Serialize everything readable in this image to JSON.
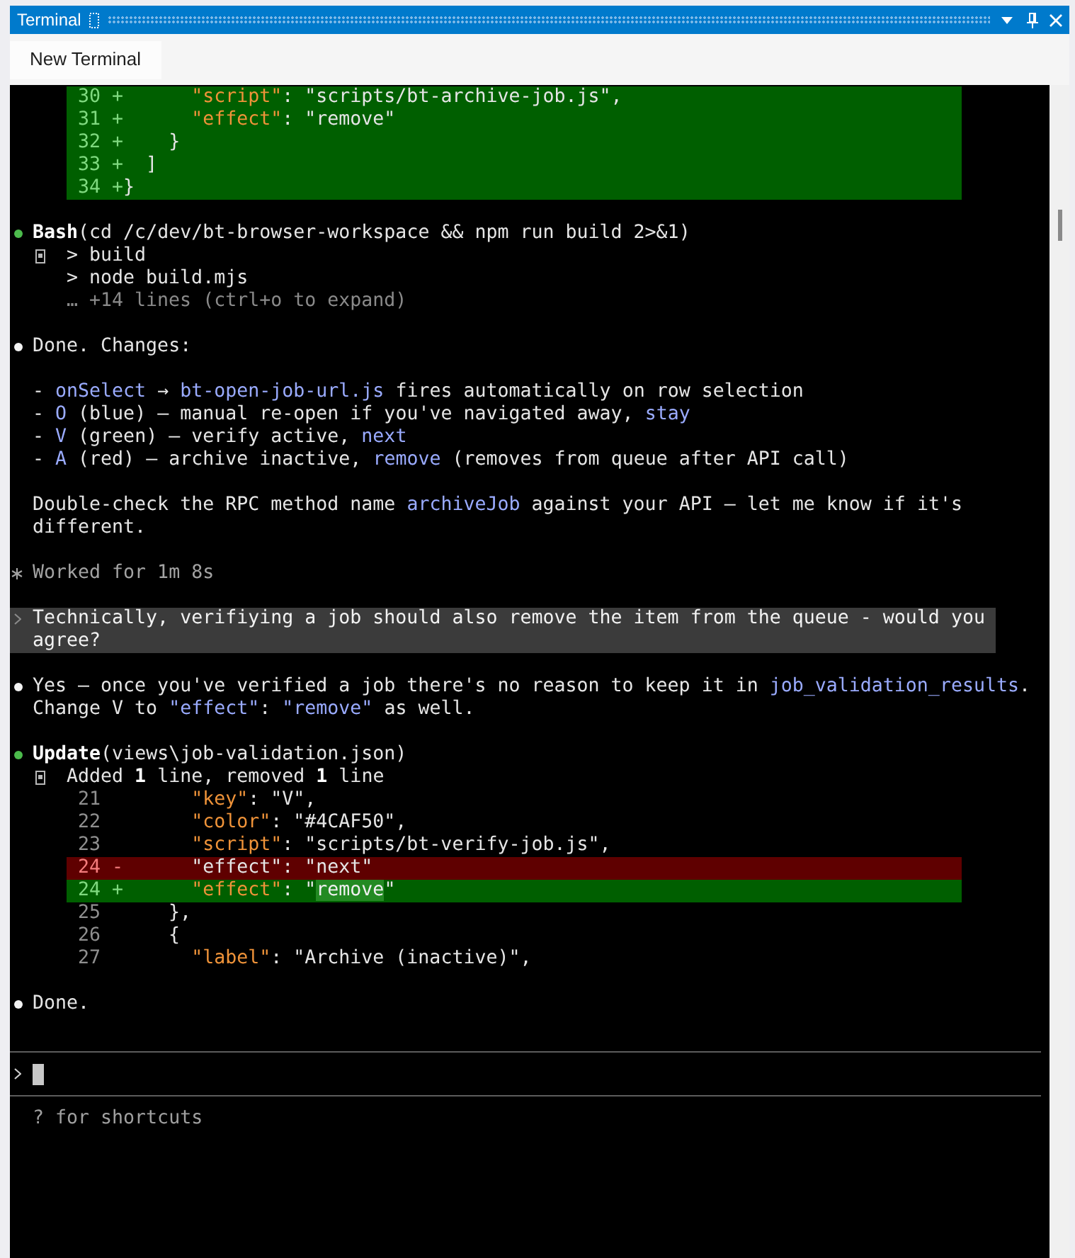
{
  "window": {
    "title": "Terminal"
  },
  "toolbar": {
    "buttons": [
      "New Terminal"
    ]
  },
  "transcript": [
    {
      "kind": "diff",
      "lines": [
        {
          "number": "30",
          "sign": "+",
          "kind": "added",
          "code": [
            {
              "text": "      \"script\"",
              "kind": "key"
            },
            {
              "text": ": \"scripts/bt-archive-job.js\",",
              "kind": "plain"
            }
          ]
        },
        {
          "number": "31",
          "sign": "+",
          "kind": "added",
          "code": [
            {
              "text": "      \"effect\"",
              "kind": "key"
            },
            {
              "text": ": \"remove\"",
              "kind": "plain"
            }
          ]
        },
        {
          "number": "32",
          "sign": "+",
          "kind": "added",
          "code": [
            {
              "text": "    }",
              "kind": "plain"
            }
          ]
        },
        {
          "number": "33",
          "sign": "+",
          "kind": "added",
          "code": [
            {
              "text": "  ]",
              "kind": "plain"
            }
          ]
        },
        {
          "number": "34",
          "sign": "+",
          "kind": "added",
          "code": [
            {
              "text": "}",
              "kind": "plain"
            }
          ]
        }
      ]
    },
    {
      "kind": "tool",
      "name": "Bash",
      "args": "(cd /c/dev/bt-browser-workspace && npm run build 2>&1)",
      "output": [
        {
          "kind": "output",
          "text": "> build"
        },
        {
          "kind": "output",
          "text": "> node build.mjs"
        },
        {
          "kind": "hint",
          "text": "… +14 lines (ctrl+o to expand)"
        }
      ]
    },
    {
      "kind": "message",
      "blocks": [
        {
          "kind": "paragraph",
          "spans": [
            {
              "kind": "text",
              "text": "Done. Changes:"
            }
          ]
        },
        {
          "kind": "list",
          "items": [
            {
              "spans": [
                {
                  "kind": "text",
                  "text": "- "
                },
                {
                  "kind": "code",
                  "text": "onSelect"
                },
                {
                  "kind": "text",
                  "text": " → "
                },
                {
                  "kind": "code",
                  "text": "bt-open-job-url.js"
                },
                {
                  "kind": "text",
                  "text": " fires automatically on row selection"
                }
              ]
            },
            {
              "spans": [
                {
                  "kind": "text",
                  "text": "- "
                },
                {
                  "kind": "code",
                  "text": "O"
                },
                {
                  "kind": "text",
                  "text": " (blue) — manual re-open if you've navigated away, "
                },
                {
                  "kind": "code",
                  "text": "stay"
                }
              ]
            },
            {
              "spans": [
                {
                  "kind": "text",
                  "text": "- "
                },
                {
                  "kind": "code",
                  "text": "V"
                },
                {
                  "kind": "text",
                  "text": " (green) — verify active, "
                },
                {
                  "kind": "code",
                  "text": "next"
                }
              ]
            },
            {
              "spans": [
                {
                  "kind": "text",
                  "text": "- "
                },
                {
                  "kind": "code",
                  "text": "A"
                },
                {
                  "kind": "text",
                  "text": " (red) — archive inactive, "
                },
                {
                  "kind": "code",
                  "text": "remove"
                },
                {
                  "kind": "text",
                  "text": " (removes from queue after API call)"
                }
              ]
            }
          ]
        },
        {
          "kind": "paragraph",
          "spans": [
            {
              "kind": "text",
              "text": "Double-check the RPC method name "
            },
            {
              "kind": "code",
              "text": "archiveJob"
            },
            {
              "kind": "text",
              "text": " against your API — let me know if it's different."
            }
          ]
        }
      ]
    },
    {
      "kind": "status",
      "text": "Worked for 1m 8s"
    },
    {
      "kind": "user",
      "text": "Technically, verifiying a job should also remove the item from the queue - would you agree?"
    },
    {
      "kind": "message",
      "blocks": [
        {
          "kind": "paragraph",
          "spans": [
            {
              "kind": "text",
              "text": "Yes — once you've verified a job there's no reason to keep it in "
            },
            {
              "kind": "code",
              "text": "job_validation_results"
            },
            {
              "kind": "text",
              "text": ". Change V to "
            },
            {
              "kind": "code",
              "text": "\"effect\""
            },
            {
              "kind": "text",
              "text": ": "
            },
            {
              "kind": "code",
              "text": "\"remove\""
            },
            {
              "kind": "text",
              "text": " as well."
            }
          ]
        }
      ]
    },
    {
      "kind": "tool",
      "name": "Update",
      "args": "(views\\job-validation.json)",
      "output": [
        {
          "kind": "summary",
          "text": "Added **1** line, removed **1** line"
        }
      ],
      "diff": [
        {
          "number": "21",
          "kind": "context",
          "code": [
            {
              "text": "      \"key\"",
              "kind": "key"
            },
            {
              "text": ": \"V\",",
              "kind": "plain"
            }
          ]
        },
        {
          "number": "22",
          "kind": "context",
          "code": [
            {
              "text": "      \"color\"",
              "kind": "key"
            },
            {
              "text": ": \"#4CAF50\",",
              "kind": "plain"
            }
          ]
        },
        {
          "number": "23",
          "kind": "context",
          "code": [
            {
              "text": "      \"script\"",
              "kind": "key"
            },
            {
              "text": ": \"scripts/bt-verify-job.js\",",
              "kind": "plain"
            }
          ]
        },
        {
          "number": "24",
          "sign": "-",
          "kind": "removed",
          "code": [
            {
              "text": "      \"effect\": \"next\"",
              "kind": "plain"
            }
          ]
        },
        {
          "number": "24",
          "sign": "+",
          "kind": "added",
          "code": [
            {
              "text": "      \"effect\"",
              "kind": "key"
            },
            {
              "text": ": \"",
              "kind": "plain"
            },
            {
              "text": "remove",
              "kind": "changed"
            },
            {
              "text": "\"",
              "kind": "plain"
            }
          ]
        },
        {
          "number": "25",
          "kind": "context",
          "code": [
            {
              "text": "    },",
              "kind": "plain"
            }
          ]
        },
        {
          "number": "26",
          "kind": "context",
          "code": [
            {
              "text": "    {",
              "kind": "plain"
            }
          ]
        },
        {
          "number": "27",
          "kind": "context",
          "code": [
            {
              "text": "      \"label\"",
              "kind": "key"
            },
            {
              "text": ": \"Archive (inactive)\",",
              "kind": "plain"
            }
          ]
        }
      ]
    },
    {
      "kind": "message",
      "blocks": [
        {
          "kind": "paragraph",
          "spans": [
            {
              "kind": "text",
              "text": "Done."
            }
          ]
        }
      ]
    }
  ],
  "prompt_input": {
    "focused": true
  },
  "hint": "? for shortcuts"
}
